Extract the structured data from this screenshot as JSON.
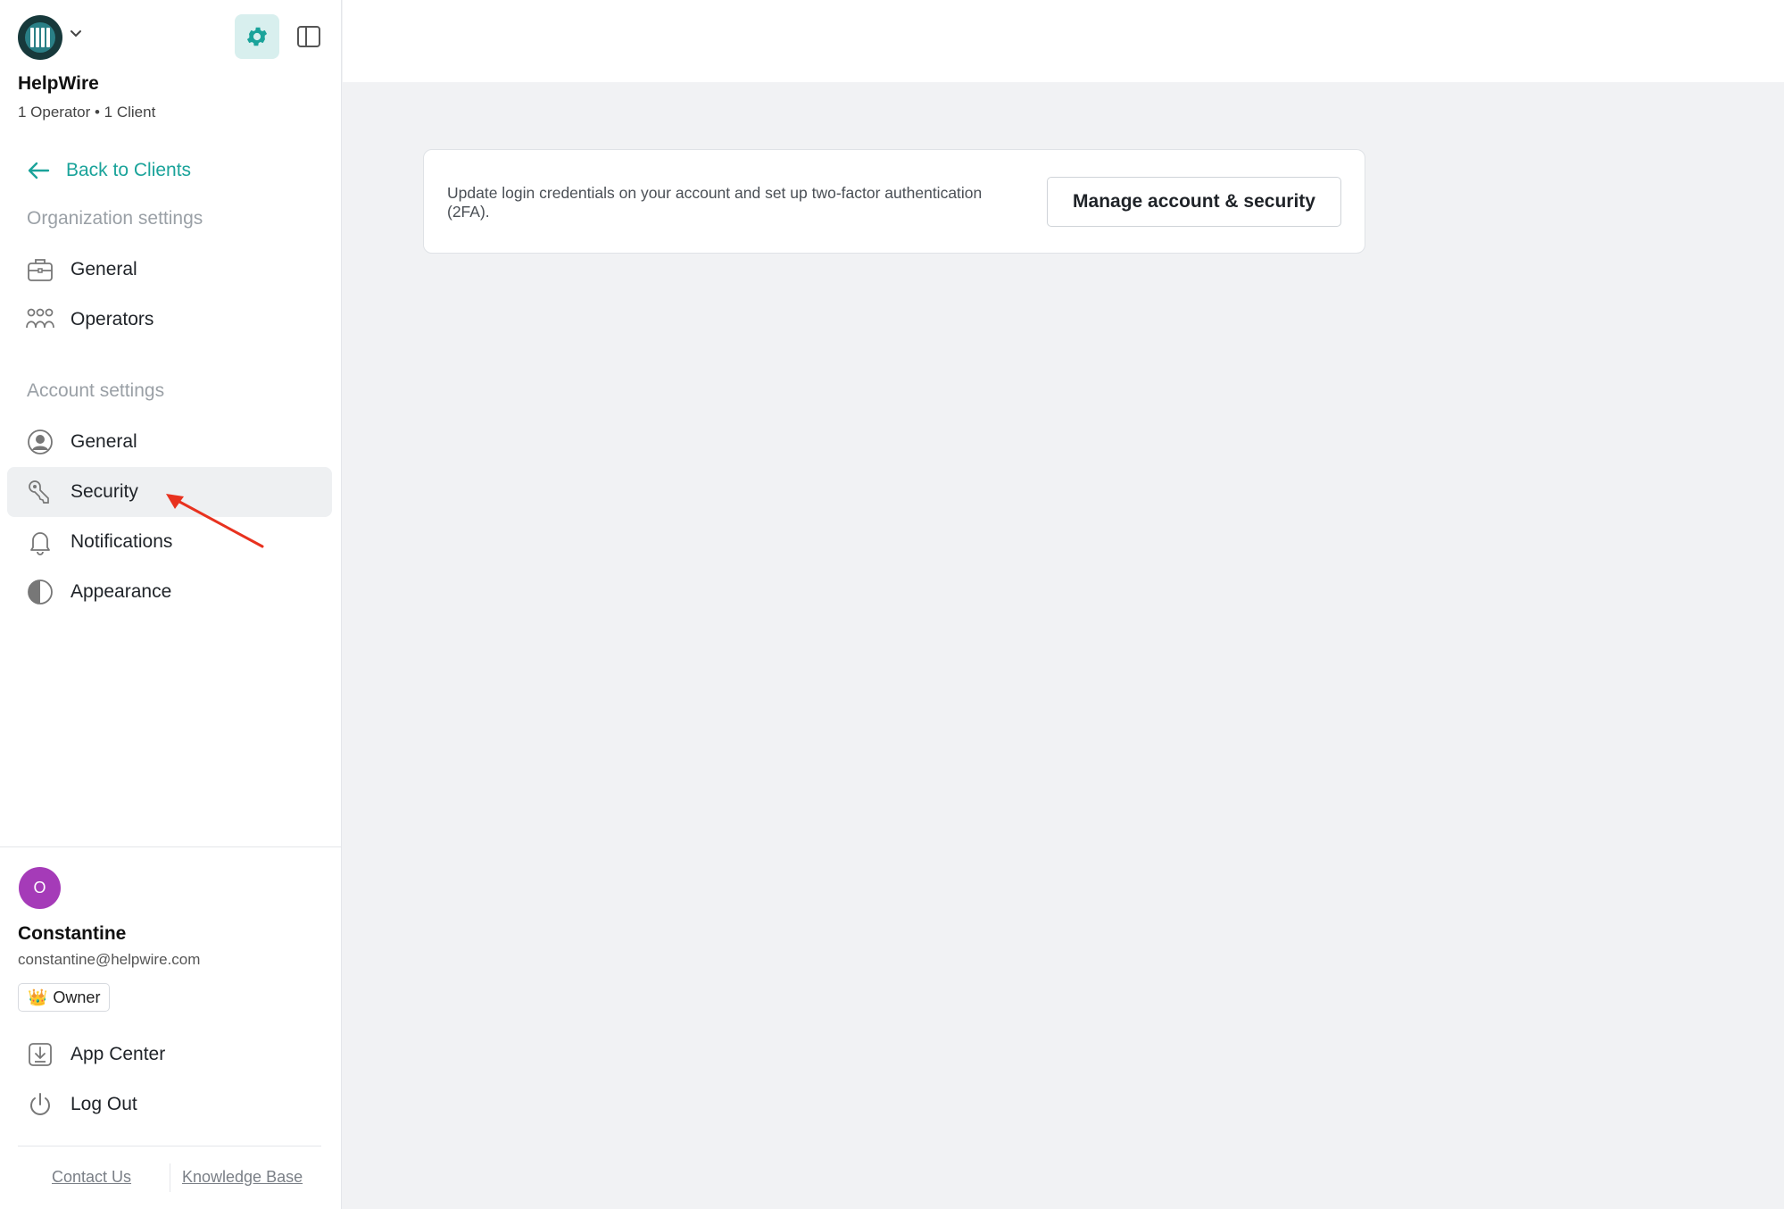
{
  "org": {
    "name": "HelpWire",
    "meta": "1 Operator • 1 Client"
  },
  "nav": {
    "back_label": "Back to Clients",
    "organization_title": "Organization settings",
    "organization_items": [
      {
        "label": "General",
        "icon": "briefcase-icon"
      },
      {
        "label": "Operators",
        "icon": "users-icon"
      }
    ],
    "account_title": "Account settings",
    "account_items": [
      {
        "label": "General",
        "icon": "user-circle-icon"
      },
      {
        "label": "Security",
        "icon": "key-icon",
        "active": true
      },
      {
        "label": "Notifications",
        "icon": "bell-icon"
      },
      {
        "label": "Appearance",
        "icon": "contrast-icon"
      }
    ]
  },
  "user": {
    "initial": "O",
    "name": "Constantine",
    "email": "constantine@helpwire.com",
    "role_emoji": "👑",
    "role": "Owner"
  },
  "footer": {
    "app_center": "App Center",
    "log_out": "Log Out",
    "contact": "Contact Us",
    "knowledge_base": "Knowledge Base"
  },
  "security_card": {
    "text": "Update login credentials on your account and set up two-factor authentication (2FA).",
    "button_label": "Manage account & security"
  },
  "colors": {
    "accent": "#1aa39a",
    "avatar": "#a53bb8",
    "annotation_arrow": "#e8321f"
  }
}
